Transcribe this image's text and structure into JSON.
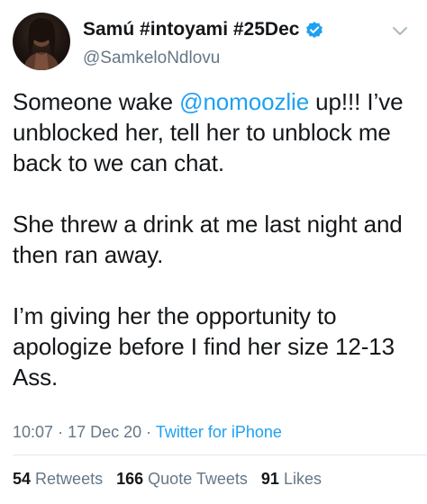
{
  "author": {
    "display_name": "Samú #intoyami #25Dec",
    "handle": "@SamkeloNdlovu",
    "verified": true,
    "avatar_icon": "profile-photo"
  },
  "tweet": {
    "line1_before": "Someone wake ",
    "mention": "@nomoozlie",
    "line1_after": " up!!! I’ve unblocked her, tell her to unblock me back to we can chat.",
    "paragraph2": "She threw a drink at me last night and then ran away.",
    "paragraph3": "I’m giving her the opportunity to apologize before I find her size 12-13 Ass."
  },
  "meta": {
    "time": "10:07",
    "separator": "·",
    "date": "17 Dec 20",
    "source": "Twitter for iPhone"
  },
  "stats": {
    "retweets_count": "54",
    "retweets_label": "Retweets",
    "quote_count": "166",
    "quote_label": "Quote Tweets",
    "likes_count": "91",
    "likes_label": "Likes"
  },
  "colors": {
    "link_blue": "#1da1f2",
    "secondary_text": "#657786",
    "primary_text": "#14171a"
  },
  "icons": {
    "verified": "verified-badge-icon",
    "more": "chevron-down-icon"
  }
}
